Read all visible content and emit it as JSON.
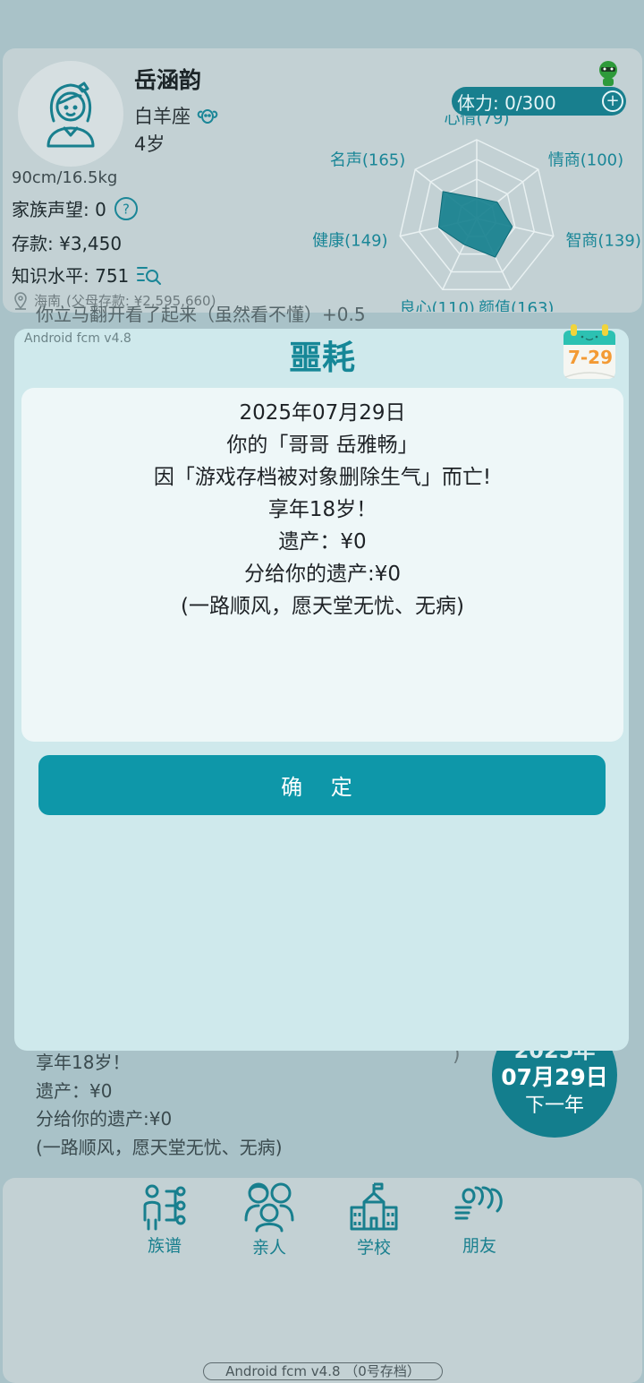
{
  "profile": {
    "name": "岳涵韵",
    "zodiac": "白羊座",
    "age": "4岁",
    "height_weight": "90cm/16.5kg",
    "family_reputation": "家族声望: 0",
    "savings": "存款: ¥3,450",
    "knowledge": "知识水平: 751",
    "location": "海南",
    "parents_savings": "(父母存款: ¥2,595,660)",
    "stamina": "体力: 0/300"
  },
  "radar": {
    "labels": [
      "心情(79)",
      "情商(100)",
      "智商(139)",
      "颜值(163)",
      "良心(110)",
      "健康(149)",
      "名声(165)"
    ],
    "values": [
      79,
      100,
      139,
      163,
      110,
      149,
      165
    ],
    "max": 300,
    "colors": {
      "fill": "#137e8d",
      "grid": "#e9f1f2",
      "label": "#1a8697"
    }
  },
  "background_log": {
    "top_line": "你立马翻开看了起来（虽然看不懂）+0.5",
    "lines": [
      "享年18岁！",
      "遗产：¥0",
      "分给你的遗产:¥0",
      "(一路顺风，愿天堂无忧、无病)"
    ]
  },
  "date_circle": {
    "year": "2025年",
    "date": "07月29日",
    "next": "下一年"
  },
  "nav": {
    "items": [
      {
        "label": "族谱",
        "icon": "family-tree-icon"
      },
      {
        "label": "亲人",
        "icon": "relatives-icon"
      },
      {
        "label": "学校",
        "icon": "school-icon"
      },
      {
        "label": "朋友",
        "icon": "friends-icon"
      }
    ],
    "version": "Android fcm v4.8 （0号存档）"
  },
  "modal": {
    "version": "Android fcm v4.8",
    "title": "噩耗",
    "calendar": "7-29",
    "lines": [
      "2025年07月29日",
      "你的「哥哥 岳雅畅」",
      "因「游戏存档被对象删除生气」而亡!",
      "享年18岁！",
      "遗产：¥0",
      "分给你的遗产:¥0",
      "(一路顺风，愿天堂无忧、无病)"
    ],
    "confirm": "确 定"
  },
  "colors": {
    "accent": "#0e97a9",
    "dark_accent": "#137e8d",
    "modal_bg": "#cfe9ec"
  }
}
